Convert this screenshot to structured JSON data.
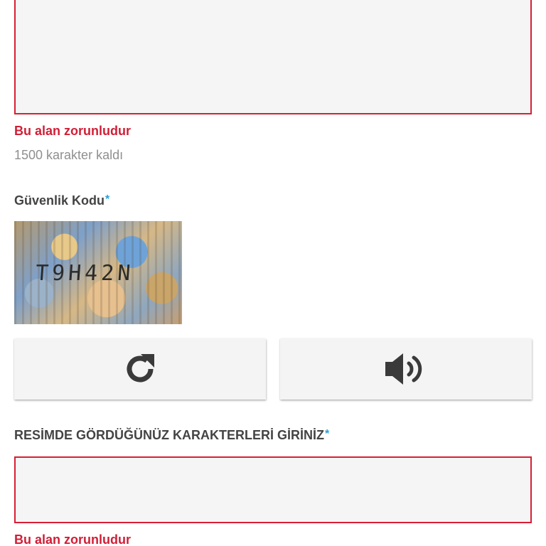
{
  "message_field": {
    "error": "Bu alan zorunludur",
    "counter": "1500 karakter kaldı"
  },
  "security": {
    "label": "Güvenlik Kodu",
    "required_mark": "*",
    "captcha_text": "T9H42N",
    "refresh_icon": "refresh-icon",
    "audio_icon": "speaker-icon"
  },
  "captcha_input": {
    "label": "RESİMDE GÖRDÜĞÜNÜZ KARAKTERLERİ GİRİNİZ",
    "required_mark": "*",
    "value": "",
    "error": "Bu alan zorunludur"
  },
  "colors": {
    "error": "#d11e36",
    "required": "#2a9fd8",
    "field_bg": "#f5f5f5"
  }
}
